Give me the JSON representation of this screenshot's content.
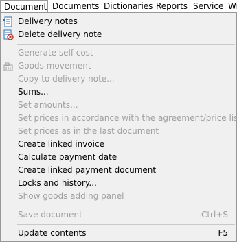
{
  "menubar": {
    "items": [
      "Document",
      "Documents",
      "Dictionaries",
      "Reports",
      "Service",
      "Wi"
    ]
  },
  "menu": {
    "delivery_notes": "Delivery notes",
    "delete_delivery_note": "Delete delivery note",
    "generate_self_cost": "Generate self-cost",
    "goods_movement": "Goods movement",
    "copy_to_delivery_note": "Copy to delivery note...",
    "sums": "Sums...",
    "set_amounts": "Set amounts...",
    "set_prices_agreement": "Set prices in accordance with the agreement/price lists",
    "set_prices_last": "Set prices as in the last document",
    "create_linked_invoice": "Create linked invoice",
    "calculate_payment_date": "Calculate payment date",
    "create_linked_payment": "Create linked payment document",
    "locks_and_history": "Locks and history...",
    "show_goods_panel": "Show goods adding panel",
    "save_document": "Save document",
    "save_document_shortcut": "Ctrl+S",
    "update_contents": "Update contents",
    "update_contents_shortcut": "F5"
  },
  "colors": {
    "menu_background": "#f0f0f0",
    "disabled_text": "#a0a0a0",
    "icon_blue": "#2a6fb5",
    "icon_red": "#c0392b"
  },
  "icons": {
    "delivery_notes": "document-list-icon",
    "delete_delivery_note": "delete-document-icon",
    "goods_movement": "goods-movement-icon"
  }
}
